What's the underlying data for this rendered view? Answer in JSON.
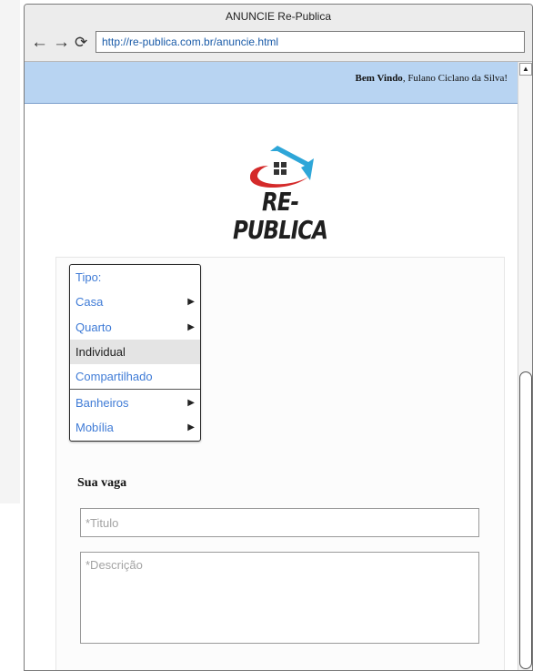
{
  "window": {
    "title": "ANUNCIE Re-Publica"
  },
  "nav": {
    "back": "←",
    "forward": "→",
    "reload": "⟳",
    "url": "http://re-publica.com.br/anuncie.html"
  },
  "welcome": {
    "greeting": "Bem Vindo",
    "user": ", Fulano Ciclano da Silva!"
  },
  "logo": {
    "text": "RE-PUBLICA",
    "icon": "house-roof-logo",
    "colors": {
      "roof": "#2ea6d8",
      "swoosh": "#d42a2a",
      "windows": "#333333"
    }
  },
  "menu": {
    "items": [
      {
        "label": "Tipo:",
        "arrow": ""
      },
      {
        "label": "Casa",
        "arrow": "▶"
      },
      {
        "label": "Quarto",
        "arrow": "▶"
      },
      {
        "label": "Individual",
        "arrow": ""
      },
      {
        "label": "Compartilhado",
        "arrow": ""
      },
      {
        "label": "Banheiros",
        "arrow": "▶"
      },
      {
        "label": "Mobília",
        "arrow": "▶"
      }
    ],
    "selected": "Individual"
  },
  "form": {
    "section_title": "Sua vaga",
    "title_placeholder": "*Titulo",
    "description_placeholder": "*Descrição"
  },
  "colors": {
    "welcome_bar": "#b8d4f2",
    "link": "#3f7bd6"
  },
  "scrollbar": {
    "up_arrow": "▲"
  }
}
